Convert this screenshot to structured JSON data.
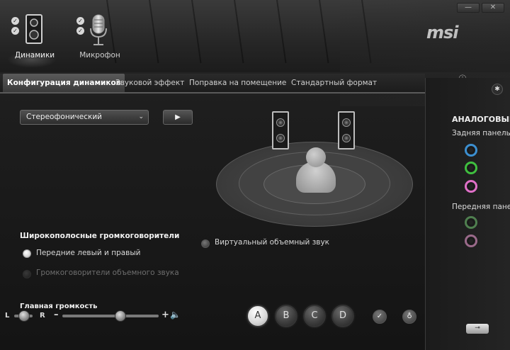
{
  "header": {
    "devices": [
      {
        "label": "Динамики",
        "icon": "speakers-icon",
        "active": true
      },
      {
        "label": "Микрофон",
        "icon": "microphone-icon",
        "active": false
      }
    ],
    "logo": "msi",
    "window": {
      "minimize": "—",
      "close": "✕"
    }
  },
  "tabs": [
    {
      "label": "Конфигурация динамиков",
      "active": true
    },
    {
      "label": "Звуковой эффект",
      "active": false
    },
    {
      "label": "Поправка на помещение",
      "active": false
    },
    {
      "label": "Стандартный формат",
      "active": false
    }
  ],
  "config": {
    "selected": "Стереофонический",
    "play": "▶"
  },
  "broadband": {
    "heading": "Широкополосные громкоговорители",
    "option_front": "Передние левый и правый",
    "option_surround": "Громкоговорители объемного звука"
  },
  "virtual_surround": "Виртуальный объемный звук",
  "volume": {
    "label": "Главная громкость",
    "left": "L",
    "right": "R",
    "minus": "–",
    "plus": "+",
    "level": 0.6
  },
  "profiles": [
    "A",
    "B",
    "C",
    "D"
  ],
  "side": {
    "title": "АНАЛОГОВЫЙ",
    "rear": "Задняя панель",
    "front": "Передняя панел",
    "rear_jacks": [
      "#3c8fd0",
      "#3fbf3f",
      "#e070c8"
    ],
    "front_jacks": [
      "#4f7f4f",
      "#9a6a8a"
    ]
  },
  "colors": {
    "accent": "#f0f0f0",
    "background": "#1e1e1e"
  }
}
